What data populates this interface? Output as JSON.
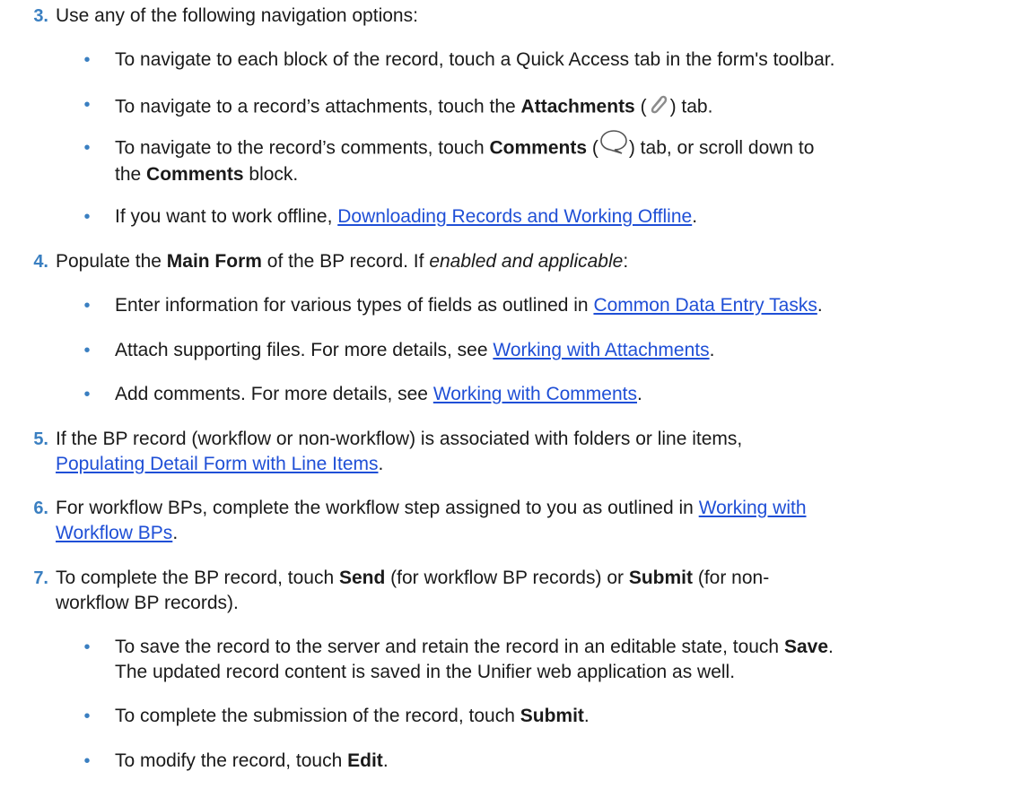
{
  "steps": [
    {
      "num": "3.",
      "text": "Use any of the following navigation options:"
    },
    {
      "num": "4.",
      "pre": "Populate the ",
      "bold": "Main Form",
      "mid": " of the BP record. If ",
      "italic": "enabled and applicable",
      "post": ":"
    },
    {
      "num": "5.",
      "line1": "If the BP record (workflow or non-workflow) is associated with folders or line items,",
      "link": "Populating Detail Form with Line Items",
      "post": "."
    },
    {
      "num": "6.",
      "pre": "For workflow BPs, complete the workflow step assigned to you as outlined in ",
      "link1": "Working with",
      "link2": "Workflow BPs",
      "post": "."
    },
    {
      "num": "7.",
      "pre": "To complete the BP record, touch ",
      "bold1": "Send",
      "mid": " (for workflow BP records) or ",
      "bold2": "Submit",
      "post1": " (for non-",
      "line2": "workflow BP records)."
    }
  ],
  "bullets": {
    "dot": "•",
    "b1": {
      "text": "To navigate to each block of the record, touch a Quick Access tab in the form's toolbar."
    },
    "b2": {
      "pre": "To navigate to a record’s attachments, touch the ",
      "bold": "Attachments",
      "open": " (",
      "icon": "paperclip-icon",
      "close": ") tab."
    },
    "b3": {
      "pre": "To navigate to the record’s comments, touch ",
      "bold": "Comments",
      "open": " (",
      "icon": "speech-bubble-icon",
      "close": ") tab, or scroll down to",
      "line2pre": "the ",
      "line2bold": "Comments",
      "line2post": " block."
    },
    "b4": {
      "pre": "If you want to work offline, ",
      "link": "Downloading Records and Working Offline",
      "post": "."
    },
    "b5": {
      "pre": "Enter information for various types of fields as outlined in ",
      "link": "Common Data Entry Tasks",
      "post": "."
    },
    "b6": {
      "pre": "Attach supporting files. For more details, see ",
      "link": "Working with Attachments",
      "post": "."
    },
    "b7": {
      "pre": "Add comments. For more details, see ",
      "link": "Working with Comments",
      "post": "."
    },
    "b8": {
      "pre": "To save the record to the server and retain the record in an editable state, touch ",
      "bold": "Save",
      "post": ".",
      "line2": "The updated record content is saved in the Unifier web application as well."
    },
    "b9": {
      "pre": "To complete the submission of the record, touch ",
      "bold": "Submit",
      "post": "."
    },
    "b10": {
      "pre": "To modify the record, touch ",
      "bold": "Edit",
      "post": "."
    }
  },
  "colors": {
    "accent": "#3a7fc1",
    "link": "#1f4fd6",
    "text": "#1a1a1a"
  }
}
